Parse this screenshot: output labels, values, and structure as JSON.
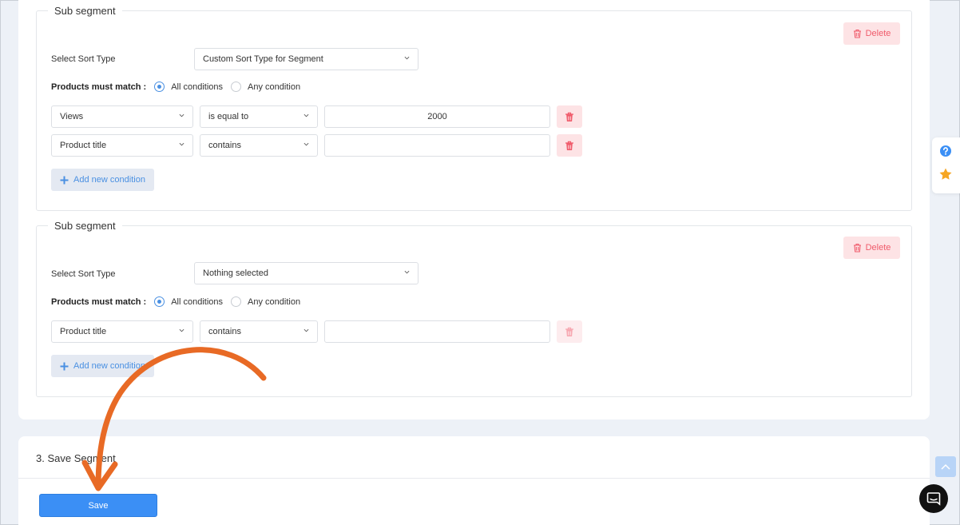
{
  "colors": {
    "accent": "#3b8ff5",
    "danger": "#f05b6b",
    "danger_bg": "#fde3e5",
    "arrow": "#e86a25"
  },
  "segments": [
    {
      "title": "Sub segment",
      "delete_label": "Delete",
      "sort_label": "Select Sort Type",
      "sort_value": "Custom Sort Type for Segment",
      "match_label": "Products must match :",
      "match_all": "All conditions",
      "match_any": "Any condition",
      "match_selected": "All conditions",
      "conditions": [
        {
          "field": "Views",
          "operator": "is equal to",
          "value": "2000"
        },
        {
          "field": "Product title",
          "operator": "contains",
          "value": ""
        }
      ],
      "add_label": "Add new condition"
    },
    {
      "title": "Sub segment",
      "delete_label": "Delete",
      "sort_label": "Select Sort Type",
      "sort_value": "Nothing selected",
      "match_label": "Products must match :",
      "match_all": "All conditions",
      "match_any": "Any condition",
      "match_selected": "All conditions",
      "conditions": [
        {
          "field": "Product title",
          "operator": "contains",
          "value": ""
        }
      ],
      "add_label": "Add new condition"
    }
  ],
  "save_section": {
    "title": "3. Save Segment",
    "save_label": "Save"
  },
  "icons": {
    "help": "question-circle-icon",
    "favorite": "star-icon",
    "scroll": "chevron-up-icon",
    "chat": "chat-bubble-icon",
    "delete": "trash-icon",
    "add": "plus-icon"
  }
}
